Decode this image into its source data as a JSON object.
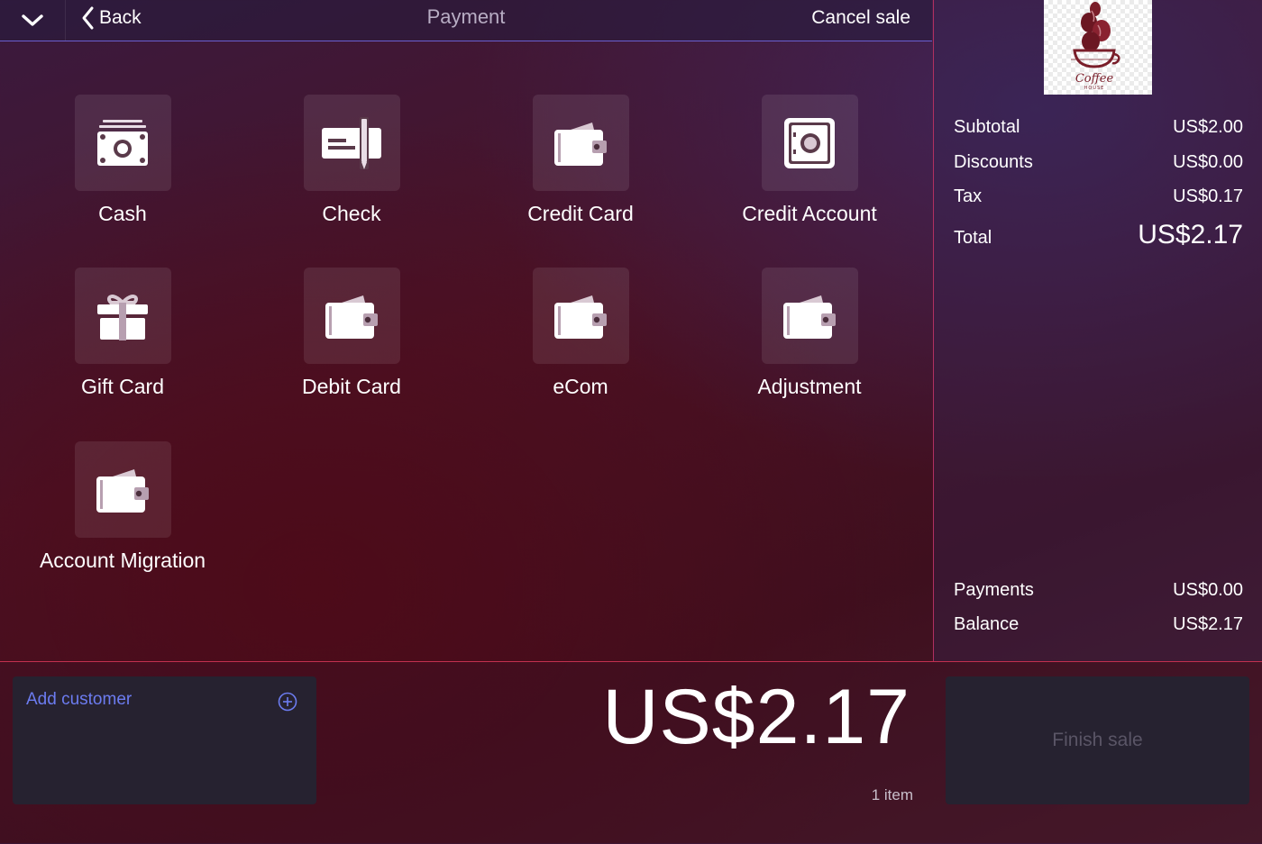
{
  "header": {
    "back_label": "Back",
    "title": "Payment",
    "cancel_label": "Cancel sale"
  },
  "payment_methods": [
    {
      "label": "Cash",
      "icon": "cash-icon"
    },
    {
      "label": "Check",
      "icon": "check-icon"
    },
    {
      "label": "Credit Card",
      "icon": "wallet-icon"
    },
    {
      "label": "Credit Account",
      "icon": "safe-icon"
    },
    {
      "label": "Gift Card",
      "icon": "gift-icon"
    },
    {
      "label": "Debit Card",
      "icon": "wallet-icon"
    },
    {
      "label": "eCom",
      "icon": "wallet-icon"
    },
    {
      "label": "Adjustment",
      "icon": "wallet-icon"
    },
    {
      "label": "Account Migration",
      "icon": "wallet-icon"
    }
  ],
  "store_logo": {
    "text_main": "Coffee",
    "text_sub": "HOUSE"
  },
  "summary": {
    "subtotal_label": "Subtotal",
    "subtotal": "US$2.00",
    "discounts_label": "Discounts",
    "discounts": "US$0.00",
    "tax_label": "Tax",
    "tax": "US$0.17",
    "total_label": "Total",
    "total": "US$2.17",
    "payments_label": "Payments",
    "payments": "US$0.00",
    "balance_label": "Balance",
    "balance": "US$2.17"
  },
  "bottom": {
    "add_customer_label": "Add customer",
    "amount_due": "US$2.17",
    "item_count": "1 item",
    "finish_label": "Finish sale"
  },
  "colors": {
    "accent_blue": "#6c7cf0",
    "header_line": "#6b5fd0",
    "divider_red": "#c2304f",
    "panel_dark": "#262230",
    "icon_tile": "#ffffff17"
  }
}
